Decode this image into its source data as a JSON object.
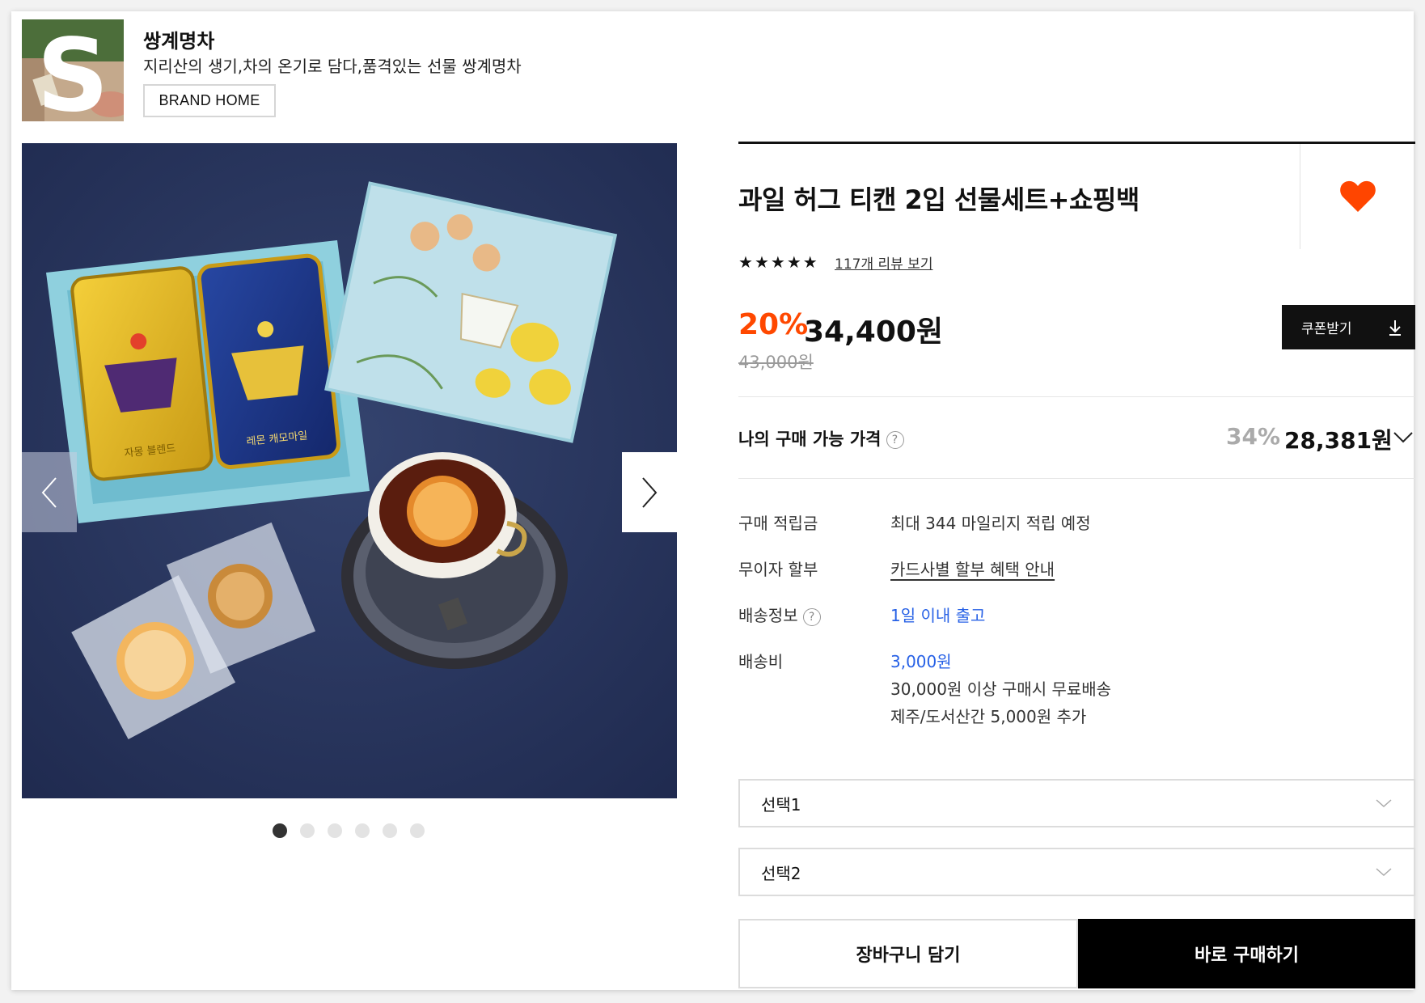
{
  "brand": {
    "name": "쌍계명차",
    "description": "지리산의 생기,차의 온기로 담다,품격있는 선물 쌍계명차",
    "home_button": "BRAND HOME",
    "logo_letter": "S"
  },
  "gallery": {
    "dots_count": 6,
    "active_index": 0,
    "tin_labels": [
      "자몽 블렌드",
      "레몬 캐모마일"
    ]
  },
  "product": {
    "title": "과일 허그 티캔 2입 선물세트+쇼핑백",
    "rating": {
      "stars": 5,
      "review_link": "117개 리뷰 보기"
    },
    "discount": "20%",
    "price": "34,400원",
    "original_price": "43,000원",
    "coupon_button": "쿠폰받기",
    "my_price": {
      "label": "나의 구매 가능 가격",
      "percent": "34%",
      "price": "28,381원"
    },
    "info": [
      {
        "label": "구매 적립금",
        "value": "최대 344 마일리지 적립 예정"
      },
      {
        "label": "무이자 할부",
        "value": "카드사별 할부 혜택 안내"
      },
      {
        "label": "배송정보",
        "value": "1일 이내 출고"
      },
      {
        "label": "배송비",
        "value": "3,000원",
        "notes": [
          "30,000원 이상 구매시 무료배송",
          "제주/도서산간 5,000원 추가"
        ]
      }
    ],
    "options": [
      "선택1",
      "선택2"
    ],
    "cart_button": "장바구니 담기",
    "buy_button": "바로 구매하기"
  },
  "colors": {
    "discount": "#ff4800",
    "heart": "#ff4500",
    "link_blue": "#2761e6",
    "primary": "#000000"
  }
}
